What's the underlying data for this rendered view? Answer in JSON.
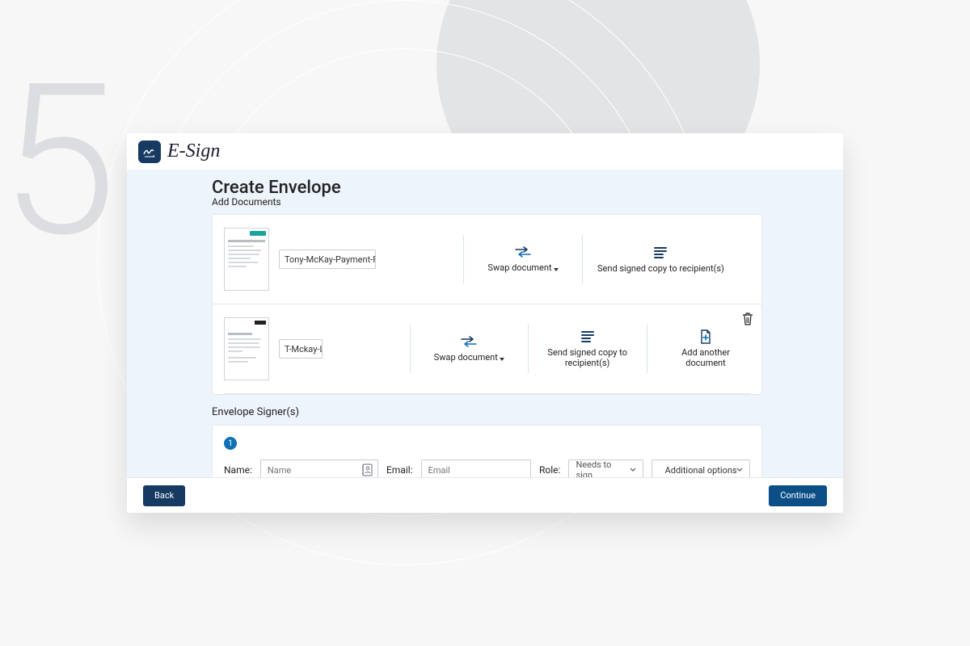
{
  "step_number": "5",
  "brand": {
    "name": "E-Sign"
  },
  "page": {
    "title": "Create Envelope",
    "subtitle": "Add Documents"
  },
  "documents": [
    {
      "name": "Tony-McKay-Payment-Fo",
      "swap_label": "Swap document",
      "send_label": "Send signed copy to recipient(s)",
      "show_add": false
    },
    {
      "name": "T-Mckay-Letting-Agreem",
      "swap_label": "Swap document",
      "send_label": "Send signed copy to recipient(s)",
      "add_label": "Add another document",
      "show_add": true
    }
  ],
  "signers": {
    "section_title": "Envelope Signer(s)",
    "index": "1",
    "name_label": "Name:",
    "name_placeholder": "Name",
    "email_label": "Email:",
    "email_placeholder": "Email",
    "role_label": "Role:",
    "role_value": "Needs to sign",
    "options_label": "Additional options"
  },
  "footer": {
    "back": "Back",
    "continue": "Continue"
  }
}
